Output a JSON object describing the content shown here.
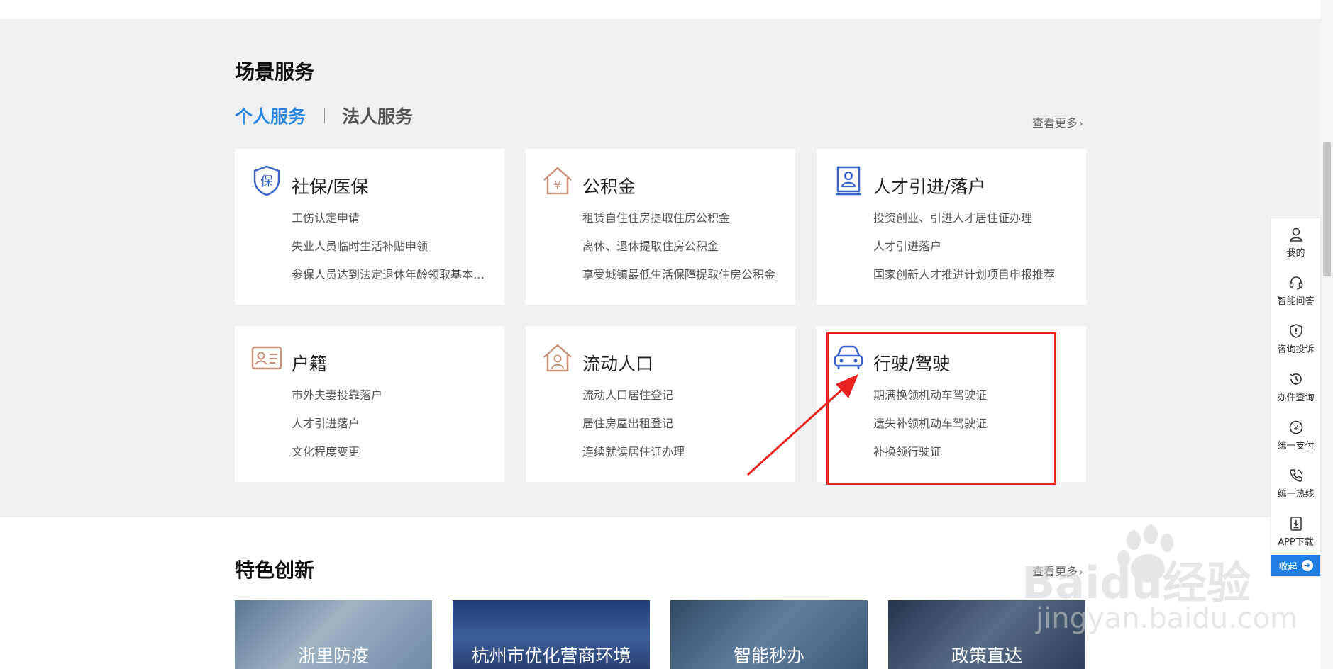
{
  "scene": {
    "title": "场景服务",
    "tabs": [
      {
        "label": "个人服务",
        "active": true
      },
      {
        "label": "法人服务",
        "active": false
      }
    ],
    "more": "查看更多",
    "cards": [
      {
        "title": "社保/医保",
        "icon": "shield-icon",
        "items": [
          "工伤认定申请",
          "失业人员临时生活补贴申领",
          "参保人员达到法定退休年龄领取基本…"
        ]
      },
      {
        "title": "公积金",
        "icon": "house-yuan-icon",
        "items": [
          "租赁自住住房提取住房公积金",
          "离休、退休提取住房公积金",
          "享受城镇最低生活保障提取住房公积金"
        ]
      },
      {
        "title": "人才引进/落户",
        "icon": "id-badge-icon",
        "items": [
          "投资创业、引进人才居住证办理",
          "人才引进落户",
          "国家创新人才推进计划项目申报推荐"
        ]
      },
      {
        "title": "户籍",
        "icon": "id-card-icon",
        "items": [
          "市外夫妻投靠落户",
          "人才引进落户",
          "文化程度变更"
        ]
      },
      {
        "title": "流动人口",
        "icon": "house-person-icon",
        "items": [
          "流动人口居住登记",
          "居住房屋出租登记",
          "连续就读居住证办理"
        ]
      },
      {
        "title": "行驶/驾驶",
        "icon": "car-icon",
        "items": [
          "期满换领机动车驾驶证",
          "遗失补领机动车驾驶证",
          "补换领行驶证"
        ]
      }
    ]
  },
  "feature": {
    "title": "特色创新",
    "more": "查看更多",
    "cards": [
      "浙里防疫",
      "杭州市优化营商环境",
      "智能秒办",
      "政策直达"
    ]
  },
  "sidebar": {
    "items": [
      {
        "label": "我的",
        "icon": "user-icon"
      },
      {
        "label": "智能问答",
        "icon": "headset-icon"
      },
      {
        "label": "咨询投诉",
        "icon": "alert-shield-icon"
      },
      {
        "label": "办件查询",
        "icon": "history-icon"
      },
      {
        "label": "统一支付",
        "icon": "yuan-icon"
      },
      {
        "label": "统一热线",
        "icon": "phone-icon"
      },
      {
        "label": "APP下载",
        "icon": "download-icon"
      }
    ],
    "collapse": "收起"
  },
  "watermark": {
    "line1": "Baidu经验",
    "line2": "jingyan.baidu.com"
  },
  "colors": {
    "accent": "#2a86e0",
    "highlight": "#e8231f",
    "icon_blue": "#3a64c8",
    "icon_tan": "#c8917a"
  }
}
